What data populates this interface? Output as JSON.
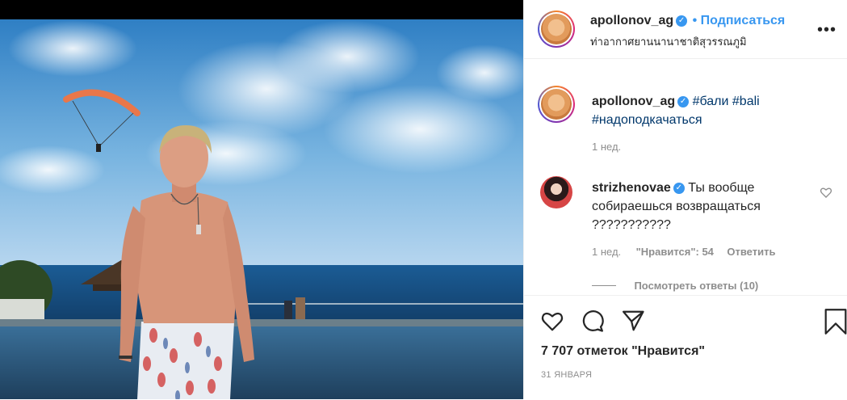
{
  "post": {
    "username": "apollonov_ag",
    "follow_label": "Подписаться",
    "location": "ท่าอากาศยานนานาชาติสุวรรณภูมิ",
    "more_label": "•••"
  },
  "caption": {
    "username": "apollonov_ag",
    "hashtags": [
      "#бали",
      "#bali",
      "#надоподкачаться"
    ],
    "time": "1 нед."
  },
  "comment": {
    "username": "strizhenovae",
    "text_line1": "Ты вообще",
    "text_line2": "собираешься возвращаться",
    "text_line3": "???????????",
    "time": "1 нед.",
    "likes_label": "\"Нравится\": 54",
    "reply_label": "Ответить",
    "view_replies": "Посмотреть ответы (10)"
  },
  "footer": {
    "likes": "7 707 отметок \"Нравится\"",
    "date": "31 ЯНВАРЯ"
  },
  "icons": {
    "like": "heart-icon",
    "comment": "comment-icon",
    "share": "share-icon",
    "save": "bookmark-icon",
    "comment_like": "small-heart-icon",
    "verified": "verified-badge-icon"
  },
  "colors": {
    "link": "#3897f0",
    "hashtag": "#00376b",
    "muted": "#8e8e8e"
  }
}
